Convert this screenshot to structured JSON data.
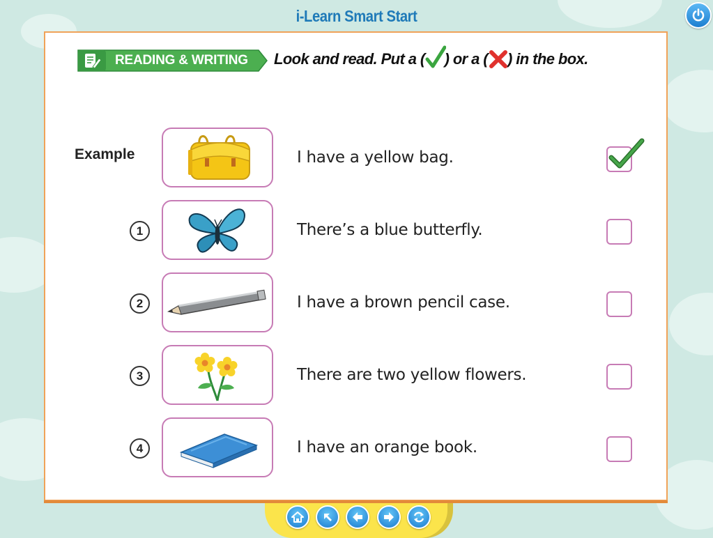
{
  "app": {
    "title": "i-Learn Smart Start"
  },
  "section": {
    "tag": "READING & WRITING"
  },
  "instruction": {
    "part1": "Look and read. Put a (",
    "part2": ") or a (",
    "part3": ") in the box."
  },
  "example": {
    "label": "Example",
    "sentence": "I have a yellow bag.",
    "answer": "check",
    "picture": "yellow-bag"
  },
  "items": [
    {
      "number": "1",
      "sentence": "There’s a blue butterfly.",
      "picture": "blue-butterfly",
      "answer": ""
    },
    {
      "number": "2",
      "sentence": "I have a brown pencil case.",
      "picture": "grey-pencil",
      "answer": ""
    },
    {
      "number": "3",
      "sentence": "There are two yellow flowers.",
      "picture": "yellow-flowers",
      "answer": ""
    },
    {
      "number": "4",
      "sentence": "I have an orange book.",
      "picture": "blue-book",
      "answer": ""
    }
  ],
  "nav": [
    {
      "name": "home",
      "icon": "home-icon"
    },
    {
      "name": "up",
      "icon": "arrow-up-left-icon"
    },
    {
      "name": "back",
      "icon": "arrow-left-icon"
    },
    {
      "name": "next",
      "icon": "arrow-right-icon"
    },
    {
      "name": "reload",
      "icon": "reload-icon"
    }
  ],
  "colors": {
    "accent": "#1f7ab8",
    "panel_border": "#f0a258",
    "frame": "#c77bb5",
    "tag_green": "#4caf50",
    "nav_yellow": "#fbe44b"
  }
}
